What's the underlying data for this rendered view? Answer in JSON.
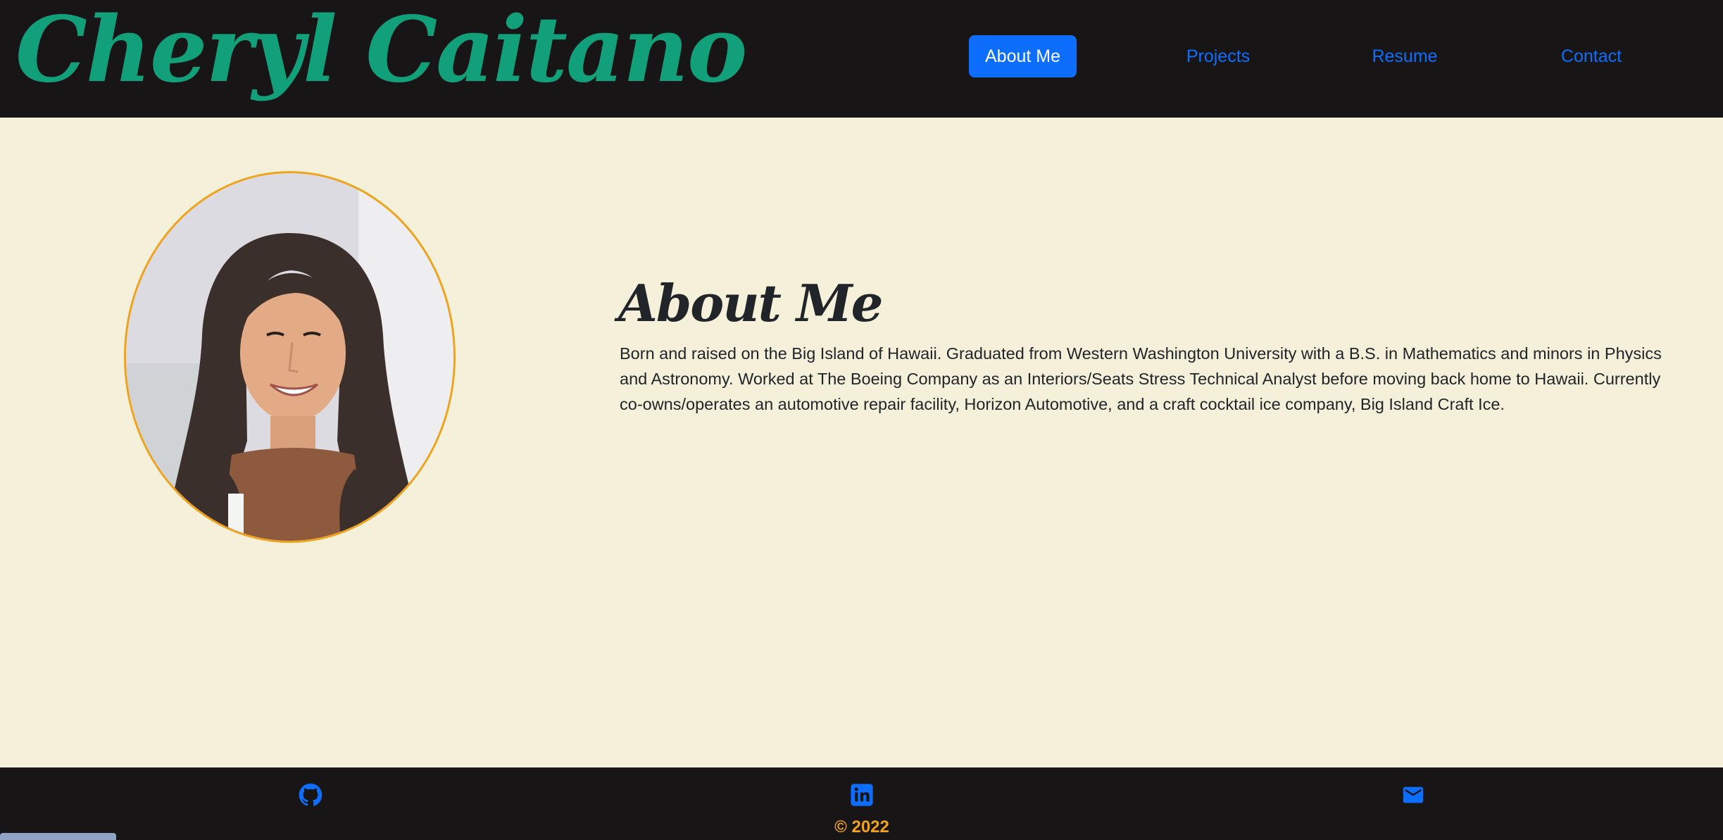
{
  "header": {
    "brand": "Cheryl Caitano",
    "nav": [
      {
        "label": "About Me",
        "active": true
      },
      {
        "label": "Projects",
        "active": false
      },
      {
        "label": "Resume",
        "active": false
      },
      {
        "label": "Contact",
        "active": false
      }
    ]
  },
  "main": {
    "title": "About Me",
    "bio": "Born and raised on the Big Island of Hawaii. Graduated from Western Washington University with a B.S. in Mathematics and minors in Physics and Astronomy. Worked at The Boeing Company as an Interiors/Seats Stress Technical Analyst before moving back home to Hawaii. Currently co-owns/operates an automotive repair facility, Horizon Automotive, and a craft cocktail ice company, Big Island Craft Ice."
  },
  "footer": {
    "icons": [
      "github-icon",
      "linkedin-icon",
      "email-icon"
    ],
    "copyright": "© 2022"
  },
  "colors": {
    "header_bg": "#181517",
    "page_bg": "#f5f0d9",
    "brand": "#12a07a",
    "accent": "#0d6efd",
    "border": "#f0a21b"
  }
}
